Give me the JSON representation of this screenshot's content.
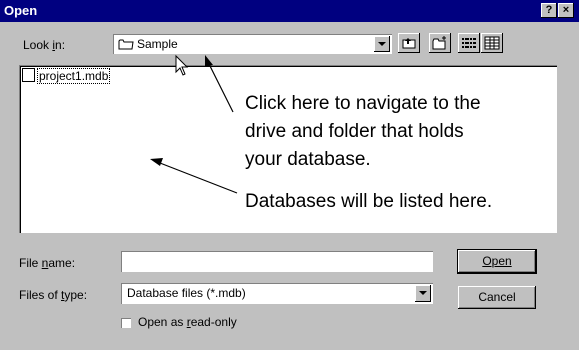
{
  "window": {
    "title": "Open",
    "help_label": "?",
    "close_label": "×"
  },
  "lookin": {
    "label": "Look in:",
    "value": "Sample",
    "icon": "folder-icon"
  },
  "toolbar": {
    "up_icon": "up-one-level-icon",
    "newfolder_icon": "new-folder-icon",
    "list_icon": "list-view-icon",
    "details_icon": "details-view-icon"
  },
  "files": [
    {
      "name": "project1.mdb",
      "icon": "database-file-icon"
    }
  ],
  "annotations": {
    "navigate_line1": "Click here to navigate to the",
    "navigate_line2": "drive and folder that holds",
    "navigate_line3": "your database.",
    "listed": "Databases will be listed here."
  },
  "filename": {
    "label": "File name:",
    "value": ""
  },
  "filetype": {
    "label": "Files of type:",
    "value": "Database files (*.mdb)"
  },
  "buttons": {
    "open": "Open",
    "cancel": "Cancel"
  },
  "readonly": {
    "label": "Open as read-only",
    "checked": false
  },
  "colors": {
    "titlebar": "#000080",
    "face": "#c0c0c0",
    "window": "#ffffff"
  }
}
